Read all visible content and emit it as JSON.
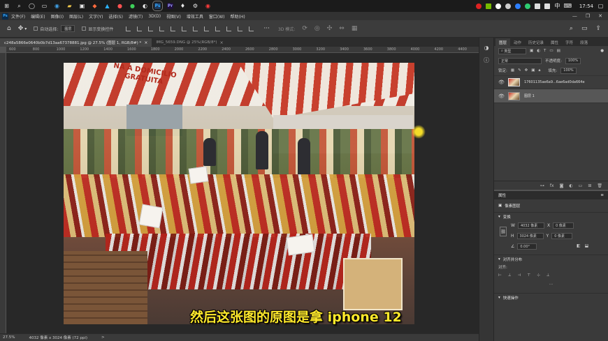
{
  "taskbar": {
    "clock": "17:54",
    "ps_label": "Ps",
    "pr_label": "Pr"
  },
  "menubar": {
    "items": [
      "文件(F)",
      "编辑(E)",
      "图像(I)",
      "图层(L)",
      "文字(Y)",
      "选择(S)",
      "滤镜(T)",
      "3D(D)",
      "视图(V)",
      "增效工具",
      "窗口(W)",
      "帮助(H)"
    ]
  },
  "options": {
    "auto_select_label": "自动选择:",
    "auto_select_value": "图层",
    "show_transform_label": "显示变换控件",
    "mode_3d_label": "3D 模式:"
  },
  "tabs": [
    {
      "label": "c248a5866e0640b0b7d13aa67378881.jpg @ 27.5% (图层 1, RGB/8#) *",
      "close": "×"
    },
    {
      "label": "IMG_5659.DNG @ 25%(RGB/8*)",
      "close": "×"
    }
  ],
  "ruler": {
    "ticks": [
      "600",
      "800",
      "1000",
      "1200",
      "1400",
      "1600",
      "1800",
      "2000",
      "2200",
      "2400",
      "2600",
      "2800",
      "3000",
      "3200",
      "3400",
      "3600",
      "3800",
      "4000",
      "4200",
      "4400"
    ]
  },
  "canvas": {
    "awning_text_1": "NA A DOMICILIO",
    "awning_text_2": "GRATUITA",
    "subtitle": "然后这张图的原图是拿 iphone 12"
  },
  "status": {
    "zoom": "27.5%",
    "doc_info": "4032 像素 x 3024 像素 (72 ppi)",
    "arrow": ">"
  },
  "layers_panel": {
    "tabs": [
      "图层",
      "动作",
      "历史记录",
      "属性",
      "字符",
      "段落"
    ],
    "filter_label": "类型",
    "blend_mode": "正常",
    "opacity_label": "不透明度:",
    "opacity_value": "100%",
    "lock_label": "锁定:",
    "fill_label": "填充:",
    "fill_value": "100%",
    "layers": [
      {
        "name": "17601135ae6a9...6ae6ad0da664e"
      },
      {
        "name": "图层 1"
      }
    ],
    "footer_icons": [
      "链接",
      "fx",
      "蒙版",
      "调整",
      "组",
      "新建",
      "删除"
    ]
  },
  "properties_panel": {
    "title": "属性",
    "pixel_layer_label": "像素图层",
    "transform_title": "变换",
    "w_label": "W",
    "w_value": "4032 像素",
    "x_label": "X",
    "x_value": "0 像素",
    "h_label": "H",
    "h_value": "3024 像素",
    "y_label": "Y",
    "y_value": "0 像素",
    "angle_value": "0.00°",
    "align_title": "对齐并分布",
    "align_label": "对齐:",
    "more": "···",
    "quick_actions_title": "快速操作"
  }
}
